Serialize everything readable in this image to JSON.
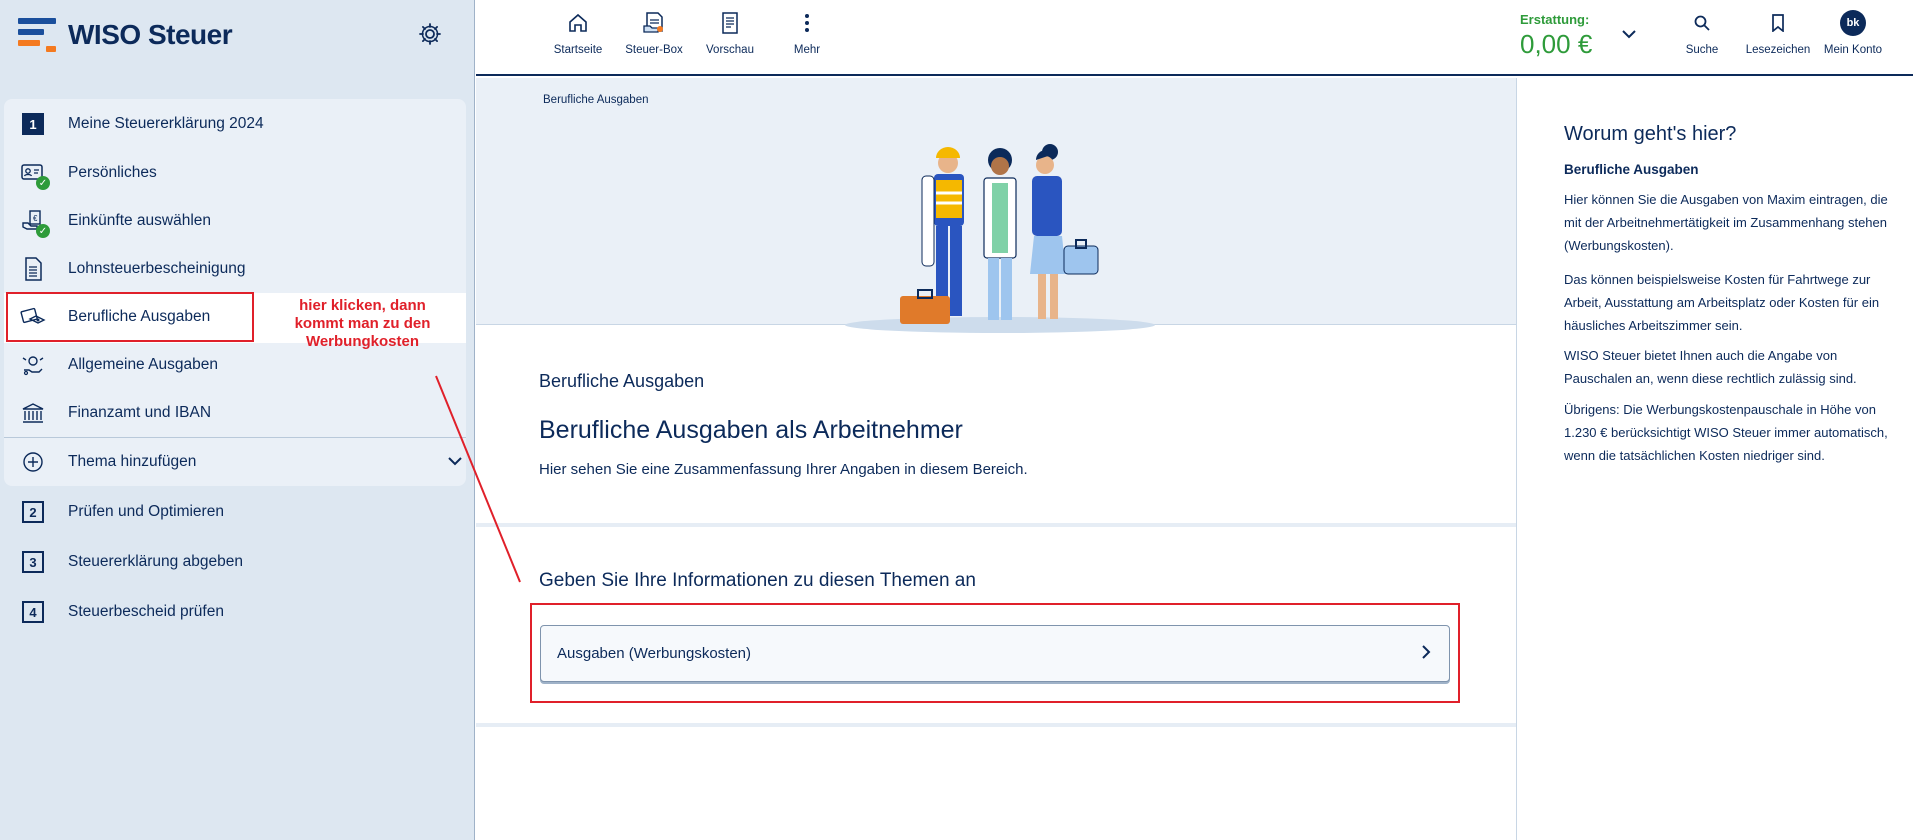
{
  "app": {
    "logo_text": "WISO Steuer"
  },
  "sidebar": {
    "items": [
      {
        "label": "Meine Steuererklärung 2024",
        "icon": "step-1-icon",
        "number": "1"
      },
      {
        "label": "Persönliches",
        "icon": "person-card-check-icon"
      },
      {
        "label": "Einkünfte auswählen",
        "icon": "income-check-icon"
      },
      {
        "label": "Lohnsteuerbescheinigung",
        "icon": "document-list-icon"
      },
      {
        "label": "Berufliche Ausgaben",
        "icon": "work-expenses-icon"
      },
      {
        "label": "Allgemeine Ausgaben",
        "icon": "general-expenses-icon"
      },
      {
        "label": "Finanzamt und IBAN",
        "icon": "bank-icon"
      },
      {
        "label": "Thema hinzufügen",
        "icon": "plus-circle-icon"
      }
    ],
    "steps": [
      {
        "number": "2",
        "label": "Prüfen und Optimieren"
      },
      {
        "number": "3",
        "label": "Steuererklärung abgeben"
      },
      {
        "number": "4",
        "label": "Steuerbescheid prüfen"
      }
    ],
    "annotation": "hier klicken, dann kommt man zu den Werbungkosten"
  },
  "topbar": {
    "nav": [
      {
        "label": "Startseite",
        "icon": "home-icon"
      },
      {
        "label": "Steuer-Box",
        "icon": "tax-box-icon"
      },
      {
        "label": "Vorschau",
        "icon": "preview-icon"
      },
      {
        "label": "Mehr",
        "icon": "more-vertical-icon"
      }
    ],
    "refund_label": "Erstattung:",
    "refund_value": "0,00 €",
    "right": [
      {
        "label": "Suche",
        "icon": "search-icon"
      },
      {
        "label": "Lesezeichen",
        "icon": "bookmark-icon"
      },
      {
        "label": "Mein Konto",
        "icon": "avatar",
        "initials": "bk"
      }
    ]
  },
  "main": {
    "breadcrumb": "Berufliche Ausgaben",
    "section_small": "Berufliche Ausgaben",
    "section_title": "Berufliche Ausgaben als Arbeitnehmer",
    "section_desc": "Hier sehen Sie eine Zusammenfassung Ihrer Angaben in diesem Bereich.",
    "info_heading": "Geben Sie Ihre Informationen zu diesen Themen an",
    "topic_card": "Ausgaben (Werbungskosten)"
  },
  "right_panel": {
    "title": "Worum geht's hier?",
    "subtitle": "Berufliche Ausgaben",
    "paragraphs": [
      "Hier können Sie die Ausgaben von Maxim eintragen, die mit der Arbeitnehmertätigkeit im Zusammenhang stehen (Werbungskosten).",
      "Das können beispielsweise Kosten für Fahrtwege zur Arbeit, Ausstattung am Arbeitsplatz oder Kosten für ein häusliches Arbeitszimmer sein.",
      "WISO Steuer bietet Ihnen auch die Angabe von Pauschalen an, wenn diese rechtlich zulässig sind.",
      "Übrigens: Die Werbungskostenpauschale in Höhe von 1.230 € berücksichtigt WISO Steuer immer automatisch, wenn die tatsächlichen Kosten niedriger sind."
    ]
  },
  "colors": {
    "navy": "#0c2a5a",
    "accent_orange": "#f47a20",
    "success_green": "#2e9b3a",
    "annotation_red": "#e0202a"
  }
}
